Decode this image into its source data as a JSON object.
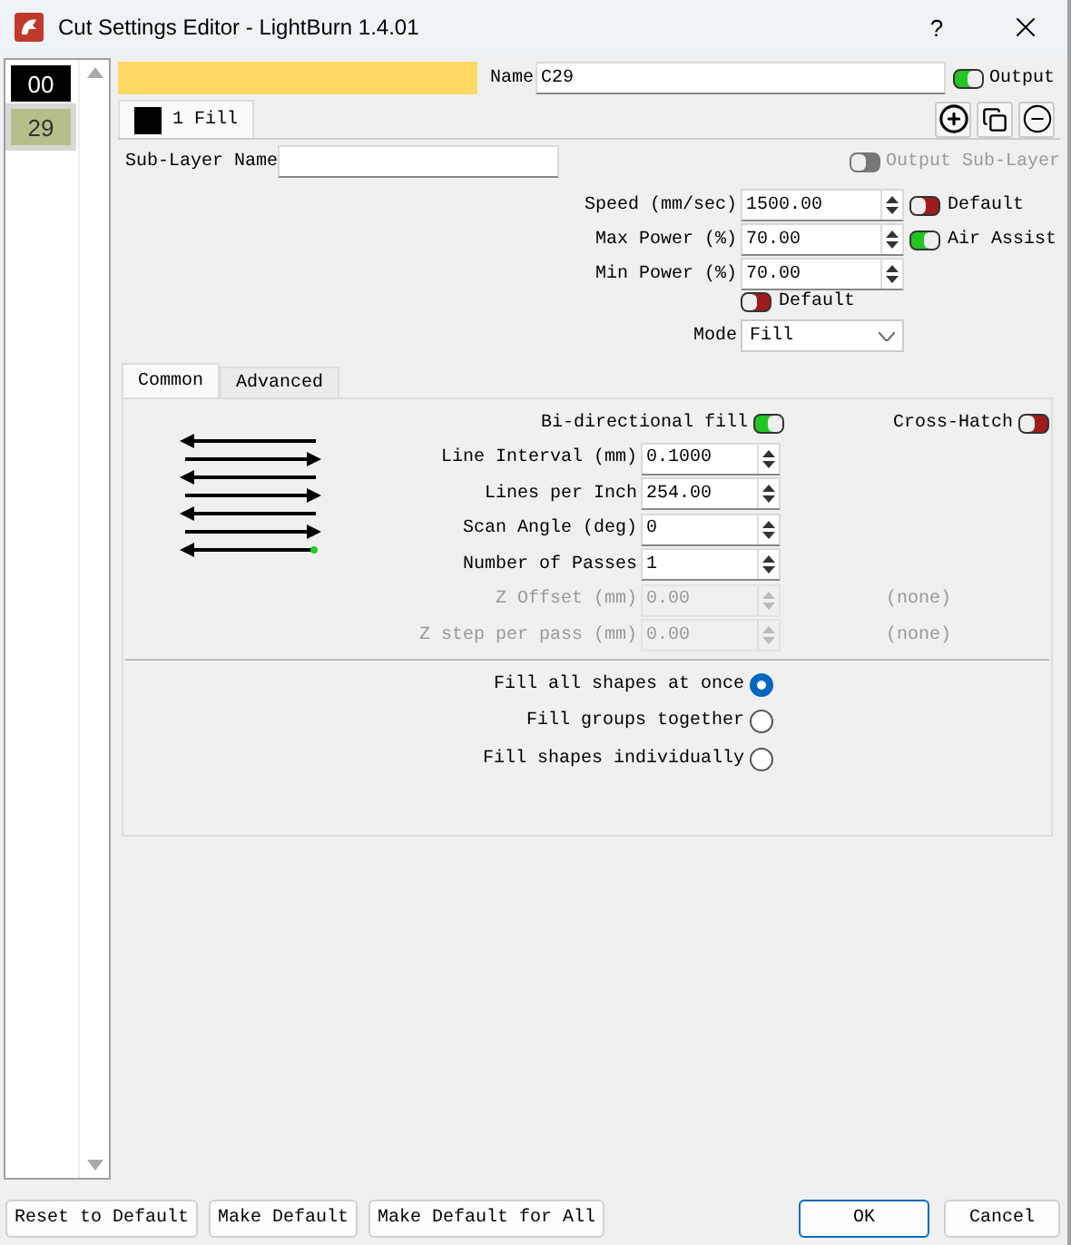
{
  "window": {
    "title": "Cut Settings Editor - LightBurn 1.4.01",
    "help": "?"
  },
  "layers": [
    {
      "label": "00",
      "color": "#000000",
      "selected": false
    },
    {
      "label": "29",
      "color": "#b7be8c",
      "selected": true
    }
  ],
  "layer": {
    "color": "#ffd966",
    "name_label": "Name",
    "name": "C29",
    "output": {
      "label": "Output",
      "on": true
    }
  },
  "sublayer_tabs": [
    {
      "label": "1 Fill",
      "color": "#000000",
      "selected": true
    }
  ],
  "sublayer_name": {
    "label": "Sub-Layer Name"
  },
  "output_sublayer": {
    "label": "Output Sub-Layer",
    "on": false,
    "disabled": true
  },
  "settings": [
    {
      "label": "Speed (mm/sec)",
      "value": "1500.00",
      "toggle": {
        "label": "Default",
        "on": false
      }
    },
    {
      "label": "Max Power (%)",
      "value": "70.00",
      "toggle": {
        "label": "Air Assist",
        "on": true
      }
    },
    {
      "label": "Min Power (%)",
      "value": "70.00"
    }
  ],
  "default_toggle": {
    "label": "Default",
    "on": false
  },
  "mode": {
    "label": "Mode",
    "value": "Fill"
  },
  "tabs": [
    {
      "label": "Common",
      "selected": true
    },
    {
      "label": "Advanced",
      "selected": false
    }
  ],
  "bidirectional": {
    "label": "Bi-directional fill",
    "on": true
  },
  "crosshatch": {
    "label": "Cross-Hatch",
    "on": false
  },
  "fill_fields": [
    {
      "label": "Line Interval (mm)",
      "value": "0.1000",
      "disabled": false
    },
    {
      "label": "Lines per Inch",
      "value": "254.00",
      "disabled": false
    },
    {
      "label": "Scan Angle (deg)",
      "value": "0",
      "disabled": false
    },
    {
      "label": "Number of Passes",
      "value": "1",
      "disabled": false
    },
    {
      "label": "Z Offset (mm)",
      "value": "0.00",
      "disabled": true,
      "note": "(none)"
    },
    {
      "label": "Z step per pass (mm)",
      "value": "0.00",
      "disabled": true,
      "note": "(none)"
    }
  ],
  "fill_order": [
    {
      "label": "Fill all shapes at once",
      "selected": true
    },
    {
      "label": "Fill groups together",
      "selected": false
    },
    {
      "label": "Fill shapes individually",
      "selected": false
    }
  ],
  "buttons_left": [
    {
      "label": "Reset to Default"
    },
    {
      "label": "Make Default"
    },
    {
      "label": "Make Default for All"
    }
  ],
  "buttons_right": [
    {
      "label": "OK",
      "focused": true
    },
    {
      "label": "Cancel",
      "focused": false
    }
  ]
}
